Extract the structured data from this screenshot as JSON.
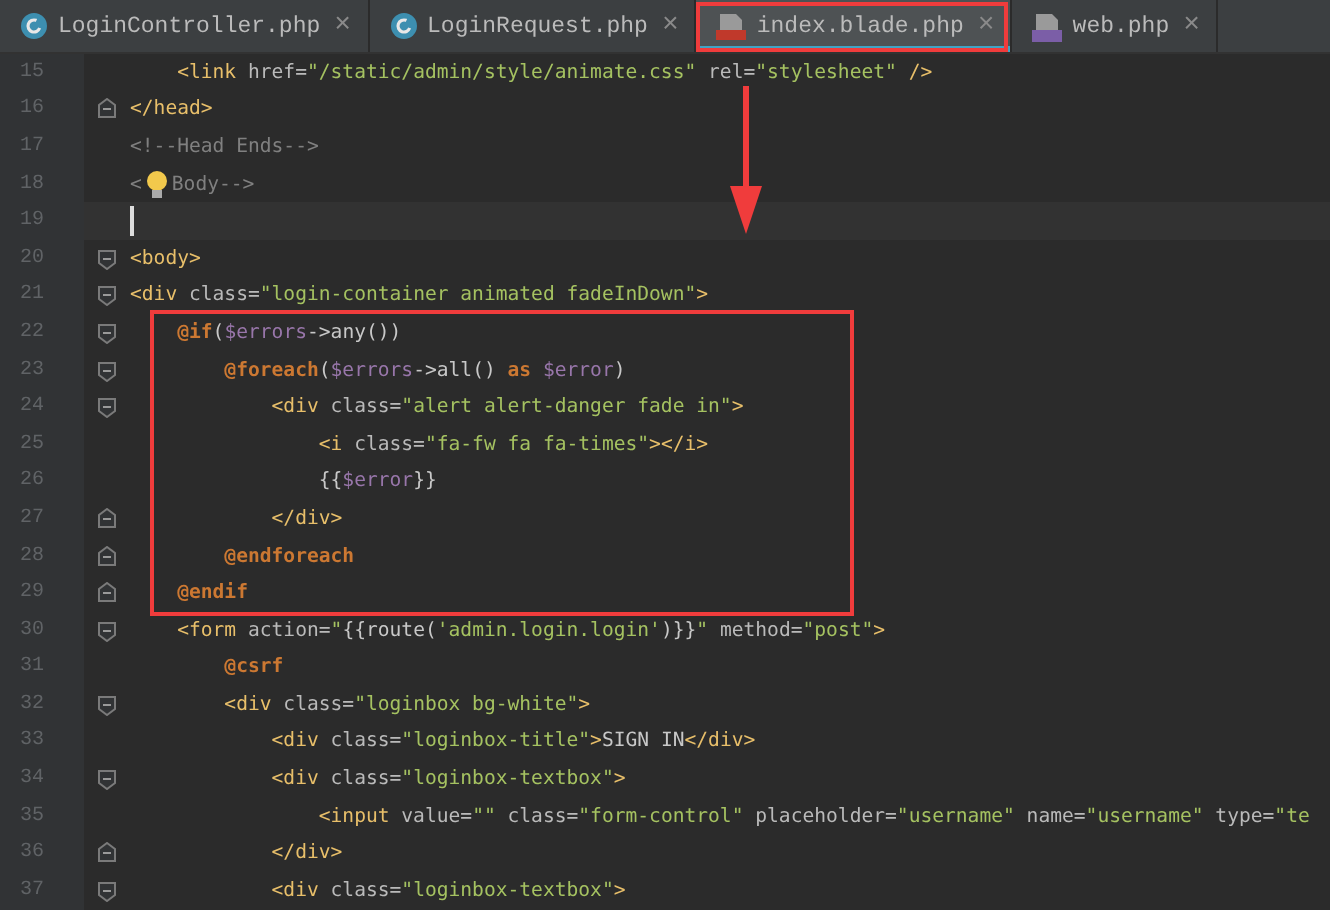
{
  "tabs": [
    {
      "label": "LoginController.php",
      "kind": "class",
      "selected": false,
      "marked": false
    },
    {
      "label": "LoginRequest.php",
      "kind": "class",
      "selected": false,
      "marked": false
    },
    {
      "label": "index.blade.php",
      "kind": "blade",
      "selected": true,
      "marked": true
    },
    {
      "label": "web.php",
      "kind": "php",
      "selected": false,
      "marked": false
    }
  ],
  "close_mark": "×",
  "editor": {
    "blocks": [
      {
        "boxed": false,
        "lines": [
          {
            "num": "15",
            "kind": "plain",
            "current": false,
            "tokens": [
              {
                "kind": "tag",
                "text": "    <link"
              },
              {
                "kind": "attr",
                "text": " href="
              },
              {
                "kind": "str",
                "text": "\"/static/admin/style/animate.css\""
              },
              {
                "kind": "attr",
                "text": " rel="
              },
              {
                "kind": "str",
                "text": "\"stylesheet\""
              },
              {
                "kind": "tag",
                "text": " />"
              }
            ]
          },
          {
            "num": "16",
            "kind": "closer",
            "current": false,
            "tokens": [
              {
                "kind": "tag",
                "text": "</head>"
              }
            ]
          },
          {
            "num": "17",
            "kind": "plain",
            "current": false,
            "tokens": [
              {
                "kind": "comment",
                "text": "<!--Head Ends-->"
              }
            ]
          },
          {
            "num": "18",
            "kind": "plain",
            "current": false,
            "tokens": [
              {
                "kind": "comment",
                "text": "<"
              },
              {
                "kind": "bulb"
              },
              {
                "kind": "comment",
                "text": "Body-->"
              }
            ]
          },
          {
            "num": "19",
            "kind": "plain",
            "current": true
          },
          {
            "num": "20",
            "kind": "opener",
            "current": false,
            "tokens": [
              {
                "kind": "tag",
                "text": "<body>"
              }
            ]
          },
          {
            "num": "21",
            "kind": "opener",
            "current": false,
            "tokens": [
              {
                "kind": "tag",
                "text": "<div"
              },
              {
                "kind": "attr",
                "text": " class="
              },
              {
                "kind": "str",
                "text": "\"login-container animated fadeInDown\""
              },
              {
                "kind": "tag",
                "text": ">"
              }
            ]
          }
        ]
      },
      {
        "boxed": true,
        "lines": [
          {
            "num": "22",
            "kind": "opener",
            "current": false,
            "tokens": [
              {
                "kind": "directive",
                "text": "    @if"
              },
              {
                "kind": "plain",
                "text": "("
              },
              {
                "kind": "var",
                "text": "$errors"
              },
              {
                "kind": "plain",
                "text": "->any())"
              }
            ]
          },
          {
            "num": "23",
            "kind": "opener",
            "current": false,
            "tokens": [
              {
                "kind": "directive",
                "text": "        @foreach"
              },
              {
                "kind": "plain",
                "text": "("
              },
              {
                "kind": "var",
                "text": "$errors"
              },
              {
                "kind": "plain",
                "text": "->all() "
              },
              {
                "kind": "directive",
                "text": "as"
              },
              {
                "kind": "var",
                "text": " $error"
              },
              {
                "kind": "plain",
                "text": ")"
              }
            ]
          },
          {
            "num": "24",
            "kind": "opener",
            "current": false,
            "tokens": [
              {
                "kind": "tag",
                "text": "            <div"
              },
              {
                "kind": "attr",
                "text": " class="
              },
              {
                "kind": "str",
                "text": "\"alert alert-danger fade in\""
              },
              {
                "kind": "tag",
                "text": ">"
              }
            ]
          },
          {
            "num": "25",
            "kind": "plain",
            "current": false,
            "tokens": [
              {
                "kind": "tag",
                "text": "                <i"
              },
              {
                "kind": "attr",
                "text": " class="
              },
              {
                "kind": "str",
                "text": "\"fa-fw fa fa-times\""
              },
              {
                "kind": "tag",
                "text": "></i>"
              }
            ]
          },
          {
            "num": "26",
            "kind": "plain",
            "current": false,
            "tokens": [
              {
                "kind": "plain",
                "text": "                {{"
              },
              {
                "kind": "var",
                "text": "$error"
              },
              {
                "kind": "plain",
                "text": "}}"
              }
            ]
          },
          {
            "num": "27",
            "kind": "closer",
            "current": false,
            "tokens": [
              {
                "kind": "tag",
                "text": "            </div>"
              }
            ]
          },
          {
            "num": "28",
            "kind": "closer",
            "current": false,
            "tokens": [
              {
                "kind": "directive",
                "text": "        @endforeach"
              }
            ]
          },
          {
            "num": "29",
            "kind": "closer",
            "current": false,
            "tokens": [
              {
                "kind": "directive",
                "text": "    @endif"
              }
            ]
          }
        ]
      },
      {
        "boxed": false,
        "lines": [
          {
            "num": "30",
            "kind": "opener",
            "current": false,
            "tokens": [
              {
                "kind": "tag",
                "text": "    <form"
              },
              {
                "kind": "attr",
                "text": " action="
              },
              {
                "kind": "str",
                "text": "\""
              },
              {
                "kind": "plain",
                "text": "{{route("
              },
              {
                "kind": "str",
                "text": "'admin.login.login'"
              },
              {
                "kind": "plain",
                "text": ")}}"
              },
              {
                "kind": "str",
                "text": "\""
              },
              {
                "kind": "attr",
                "text": " method="
              },
              {
                "kind": "str",
                "text": "\"post\""
              },
              {
                "kind": "tag",
                "text": ">"
              }
            ]
          },
          {
            "num": "31",
            "kind": "plain",
            "current": false,
            "tokens": [
              {
                "kind": "directive",
                "text": "        @csrf"
              }
            ]
          },
          {
            "num": "32",
            "kind": "opener",
            "current": false,
            "tokens": [
              {
                "kind": "tag",
                "text": "        <div"
              },
              {
                "kind": "attr",
                "text": " class="
              },
              {
                "kind": "str",
                "text": "\"loginbox bg-white\""
              },
              {
                "kind": "tag",
                "text": ">"
              }
            ]
          },
          {
            "num": "33",
            "kind": "plain",
            "current": false,
            "tokens": [
              {
                "kind": "tag",
                "text": "            <div"
              },
              {
                "kind": "attr",
                "text": " class="
              },
              {
                "kind": "str",
                "text": "\"loginbox-title\""
              },
              {
                "kind": "tag",
                "text": ">"
              },
              {
                "kind": "plain",
                "text": "SIGN IN"
              },
              {
                "kind": "tag",
                "text": "</div>"
              }
            ]
          },
          {
            "num": "34",
            "kind": "opener",
            "current": false,
            "tokens": [
              {
                "kind": "tag",
                "text": "            <div"
              },
              {
                "kind": "attr",
                "text": " class="
              },
              {
                "kind": "str",
                "text": "\"loginbox-textbox\""
              },
              {
                "kind": "tag",
                "text": ">"
              }
            ]
          },
          {
            "num": "35",
            "kind": "plain",
            "current": false,
            "tokens": [
              {
                "kind": "tag",
                "text": "                <input"
              },
              {
                "kind": "attr",
                "text": " value="
              },
              {
                "kind": "str",
                "text": "\"\""
              },
              {
                "kind": "attr",
                "text": " class="
              },
              {
                "kind": "str",
                "text": "\"form-control\""
              },
              {
                "kind": "attr",
                "text": " placeholder="
              },
              {
                "kind": "str",
                "text": "\"username\""
              },
              {
                "kind": "attr",
                "text": " name="
              },
              {
                "kind": "str",
                "text": "\"username\""
              },
              {
                "kind": "attr",
                "text": " type="
              },
              {
                "kind": "str",
                "text": "\"te"
              }
            ]
          },
          {
            "num": "36",
            "kind": "closer",
            "current": false,
            "tokens": [
              {
                "kind": "tag",
                "text": "            </div>"
              }
            ]
          },
          {
            "num": "37",
            "kind": "opener",
            "current": false,
            "tokens": [
              {
                "kind": "tag",
                "text": "            <div"
              },
              {
                "kind": "attr",
                "text": " class="
              },
              {
                "kind": "str",
                "text": "\"loginbox-textbox\""
              },
              {
                "kind": "tag",
                "text": ">"
              }
            ]
          }
        ]
      }
    ]
  }
}
